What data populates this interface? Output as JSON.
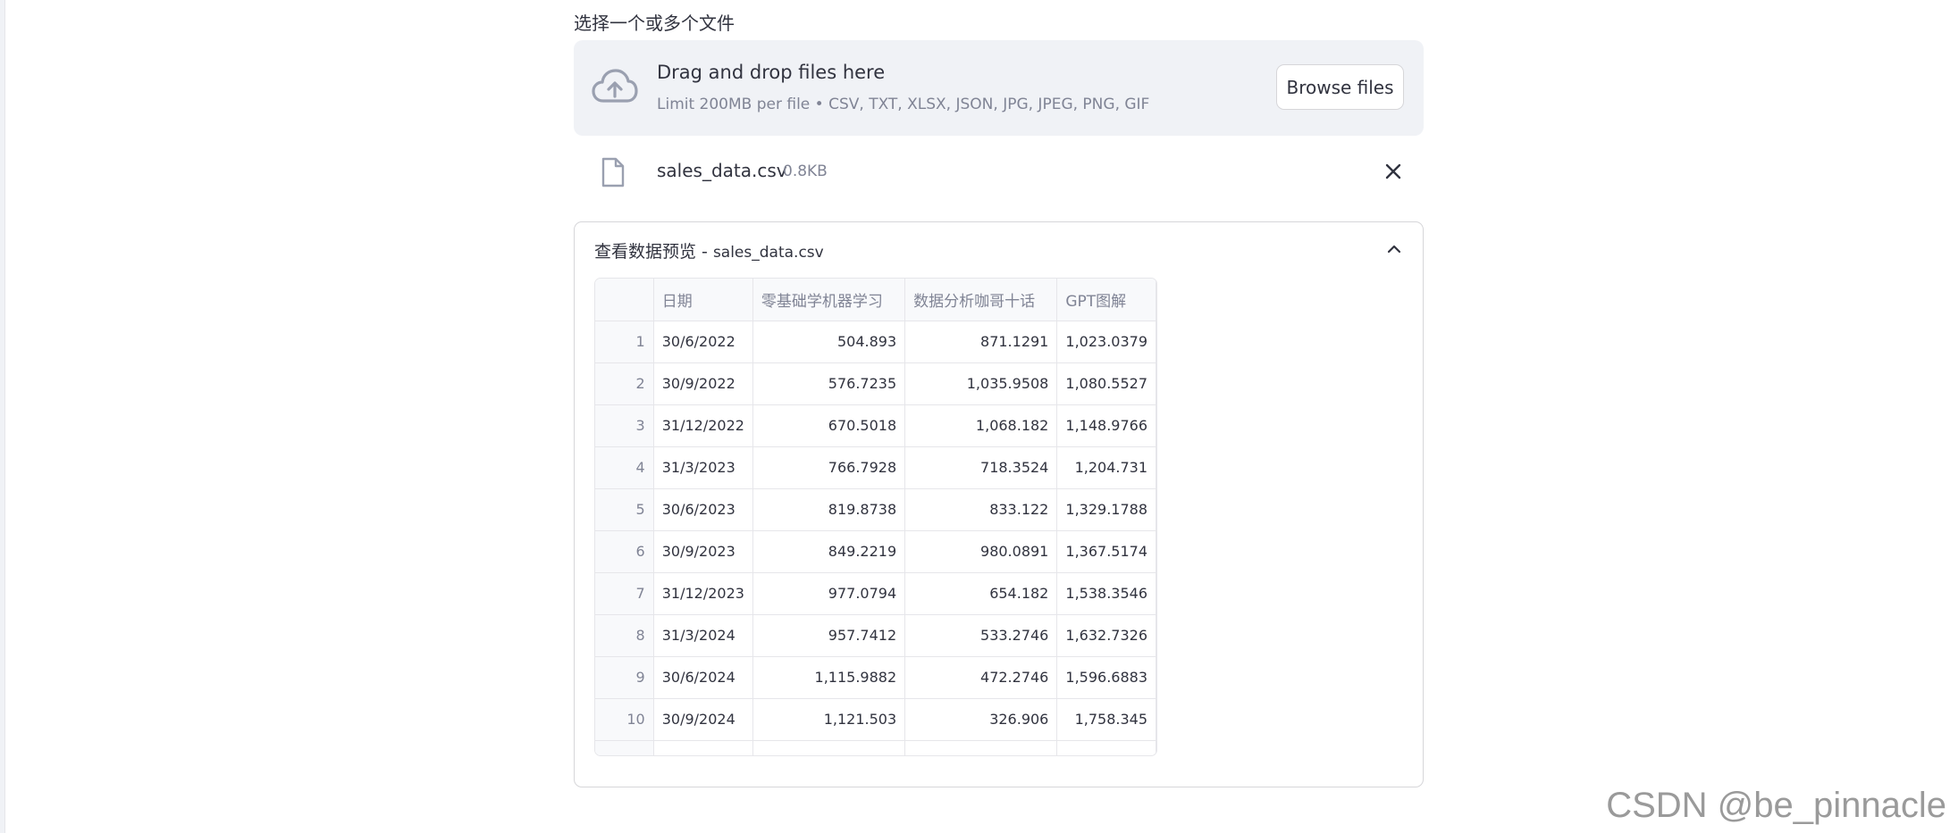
{
  "uploader": {
    "label": "选择一个或多个文件",
    "drop_title": "Drag and drop files here",
    "drop_subtitle": "Limit 200MB per file • CSV, TXT, XLSX, JSON, JPG, JPEG, PNG, GIF",
    "browse_label": "Browse files",
    "icon": "cloud-upload-icon"
  },
  "uploaded_file": {
    "name": "sales_data.csv",
    "size": "0.8KB",
    "icon": "file-icon"
  },
  "expander": {
    "title_prefix": "查看数据预览 - ",
    "title_file": "sales_data.csv",
    "expanded": true
  },
  "table": {
    "columns": [
      "",
      "日期",
      "零基础学机器学习",
      "数据分析咖哥十话",
      "GPT图解"
    ],
    "rows": [
      {
        "idx": "1",
        "date": "30/6/2022",
        "a": "504.893",
        "b": "871.1291",
        "c": "1,023.0379"
      },
      {
        "idx": "2",
        "date": "30/9/2022",
        "a": "576.7235",
        "b": "1,035.9508",
        "c": "1,080.5527"
      },
      {
        "idx": "3",
        "date": "31/12/2022",
        "a": "670.5018",
        "b": "1,068.182",
        "c": "1,148.9766"
      },
      {
        "idx": "4",
        "date": "31/3/2023",
        "a": "766.7928",
        "b": "718.3524",
        "c": "1,204.731"
      },
      {
        "idx": "5",
        "date": "30/6/2023",
        "a": "819.8738",
        "b": "833.122",
        "c": "1,329.1788"
      },
      {
        "idx": "6",
        "date": "30/9/2023",
        "a": "849.2219",
        "b": "980.0891",
        "c": "1,367.5174"
      },
      {
        "idx": "7",
        "date": "31/12/2023",
        "a": "977.0794",
        "b": "654.182",
        "c": "1,538.3546"
      },
      {
        "idx": "8",
        "date": "31/3/2024",
        "a": "957.7412",
        "b": "533.2746",
        "c": "1,632.7326"
      },
      {
        "idx": "9",
        "date": "30/6/2024",
        "a": "1,115.9882",
        "b": "472.2746",
        "c": "1,596.6883"
      },
      {
        "idx": "10",
        "date": "30/9/2024",
        "a": "1,121.503",
        "b": "326.906",
        "c": "1,758.345"
      }
    ]
  },
  "watermark": "CSDN @be_pinnacle",
  "colors": {
    "dropzone_bg": "#f0f2f6",
    "text": "#31333f",
    "muted": "#808495",
    "border": "#d6d6d9"
  }
}
